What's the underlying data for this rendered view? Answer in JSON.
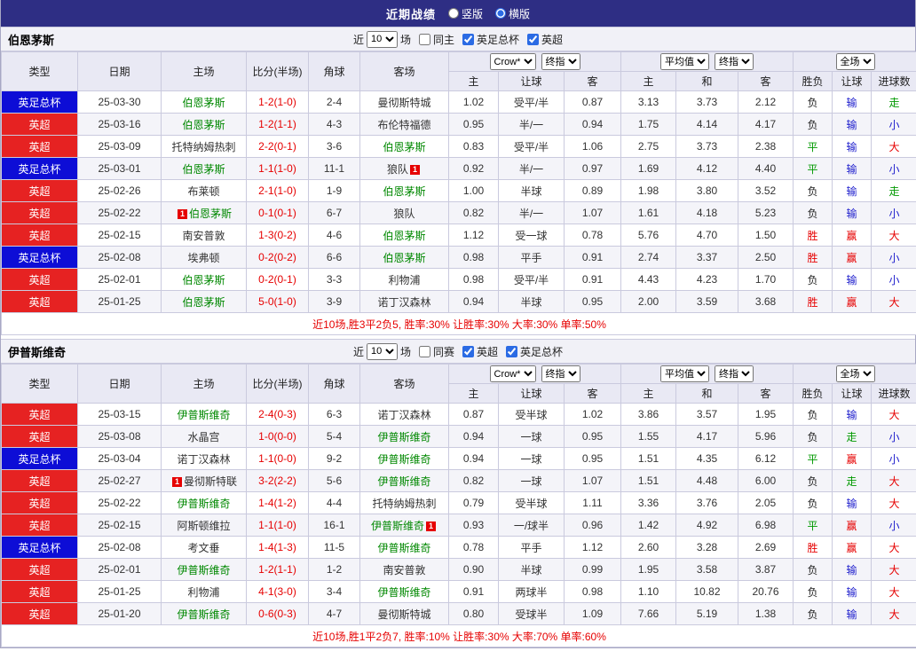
{
  "topbar": {
    "title": "近期战绩",
    "layout_options": [
      {
        "label": "竖版",
        "selected": false
      },
      {
        "label": "横版",
        "selected": true
      }
    ]
  },
  "columns": {
    "type": "类型",
    "date": "日期",
    "home": "主场",
    "score": "比分(半场)",
    "corner": "角球",
    "away": "客场",
    "sub": [
      "主",
      "让球",
      "客",
      "主",
      "和",
      "客",
      "胜负",
      "让球",
      "进球数"
    ]
  },
  "dropdowns": {
    "bookmaker": "Crow*",
    "final": "终指",
    "average": "平均值",
    "scope": "全场"
  },
  "competition_colors": {
    "英超": "red",
    "英足总杯": "blue"
  },
  "result_color_map": {
    "胜": "red",
    "赢": "red",
    "大": "red",
    "平": "green",
    "走": "green",
    "负": "dark",
    "输": "blue",
    "小": "blue"
  },
  "colors": {
    "topbar_bg": "#2e2e84",
    "league_badge_red": "#e62222",
    "cup_badge_blue": "#0d0dd6",
    "win_red": "#e60000",
    "draw_green": "#009900",
    "lose_blue": "#1c1ccc",
    "focus_team_green": "#008800",
    "summary_red": "#e60000"
  },
  "sections": [
    {
      "team": "伯恩茅斯",
      "filter": {
        "near_label": "近",
        "count": "10",
        "unit_label": "场",
        "same_label": "同主",
        "same_checked": false,
        "competitions": [
          {
            "label": "英足总杯",
            "checked": true
          },
          {
            "label": "英超",
            "checked": true
          }
        ]
      },
      "rows": [
        {
          "comp": "英足总杯",
          "date": "25-03-30",
          "home": "伯恩茅斯",
          "score": "1-2(1-0)",
          "corner": "2-4",
          "away": "曼彻斯特城",
          "odds": [
            "1.02",
            "受平/半",
            "0.87",
            "3.13",
            "3.73",
            "2.12"
          ],
          "results": [
            "负",
            "输",
            "走"
          ]
        },
        {
          "comp": "英超",
          "date": "25-03-16",
          "home": "伯恩茅斯",
          "score": "1-2(1-1)",
          "corner": "4-3",
          "away": "布伦特福德",
          "odds": [
            "0.95",
            "半/一",
            "0.94",
            "1.75",
            "4.14",
            "4.17"
          ],
          "results": [
            "负",
            "输",
            "小"
          ]
        },
        {
          "comp": "英超",
          "date": "25-03-09",
          "home": "托特纳姆热刺",
          "score": "2-2(0-1)",
          "corner": "3-6",
          "away": "伯恩茅斯",
          "odds": [
            "0.83",
            "受平/半",
            "1.06",
            "2.75",
            "3.73",
            "2.38"
          ],
          "results": [
            "平",
            "输",
            "大"
          ]
        },
        {
          "comp": "英足总杯",
          "date": "25-03-01",
          "home": "伯恩茅斯",
          "score": "1-1(1-0)",
          "corner": "11-1",
          "away": "狼队",
          "away_card": "right",
          "odds": [
            "0.92",
            "半/一",
            "0.97",
            "1.69",
            "4.12",
            "4.40"
          ],
          "results": [
            "平",
            "输",
            "小"
          ]
        },
        {
          "comp": "英超",
          "date": "25-02-26",
          "home": "布莱顿",
          "score": "2-1(1-0)",
          "corner": "1-9",
          "away": "伯恩茅斯",
          "odds": [
            "1.00",
            "半球",
            "0.89",
            "1.98",
            "3.80",
            "3.52"
          ],
          "results": [
            "负",
            "输",
            "走"
          ]
        },
        {
          "comp": "英超",
          "date": "25-02-22",
          "home": "伯恩茅斯",
          "home_card": "left",
          "score": "0-1(0-1)",
          "corner": "6-7",
          "away": "狼队",
          "odds": [
            "0.82",
            "半/一",
            "1.07",
            "1.61",
            "4.18",
            "5.23"
          ],
          "results": [
            "负",
            "输",
            "小"
          ]
        },
        {
          "comp": "英超",
          "date": "25-02-15",
          "home": "南安普敦",
          "score": "1-3(0-2)",
          "corner": "4-6",
          "away": "伯恩茅斯",
          "odds": [
            "1.12",
            "受一球",
            "0.78",
            "5.76",
            "4.70",
            "1.50"
          ],
          "results": [
            "胜",
            "赢",
            "大"
          ]
        },
        {
          "comp": "英足总杯",
          "date": "25-02-08",
          "home": "埃弗顿",
          "score": "0-2(0-2)",
          "corner": "6-6",
          "away": "伯恩茅斯",
          "odds": [
            "0.98",
            "平手",
            "0.91",
            "2.74",
            "3.37",
            "2.50"
          ],
          "results": [
            "胜",
            "赢",
            "小"
          ]
        },
        {
          "comp": "英超",
          "date": "25-02-01",
          "home": "伯恩茅斯",
          "score": "0-2(0-1)",
          "corner": "3-3",
          "away": "利物浦",
          "odds": [
            "0.98",
            "受平/半",
            "0.91",
            "4.43",
            "4.23",
            "1.70"
          ],
          "results": [
            "负",
            "输",
            "小"
          ]
        },
        {
          "comp": "英超",
          "date": "25-01-25",
          "home": "伯恩茅斯",
          "score": "5-0(1-0)",
          "corner": "3-9",
          "away": "诺丁汉森林",
          "odds": [
            "0.94",
            "半球",
            "0.95",
            "2.00",
            "3.59",
            "3.68"
          ],
          "results": [
            "胜",
            "赢",
            "大"
          ]
        }
      ],
      "summary": "近10场,胜3平2负5, 胜率:30% 让胜率:30% 大率:30% 单率:50%"
    },
    {
      "team": "伊普斯维奇",
      "filter": {
        "near_label": "近",
        "count": "10",
        "unit_label": "场",
        "same_label": "同赛",
        "same_checked": false,
        "competitions": [
          {
            "label": "英超",
            "checked": true
          },
          {
            "label": "英足总杯",
            "checked": true
          }
        ]
      },
      "rows": [
        {
          "comp": "英超",
          "date": "25-03-15",
          "home": "伊普斯维奇",
          "score": "2-4(0-3)",
          "corner": "6-3",
          "away": "诺丁汉森林",
          "odds": [
            "0.87",
            "受半球",
            "1.02",
            "3.86",
            "3.57",
            "1.95"
          ],
          "results": [
            "负",
            "输",
            "大"
          ]
        },
        {
          "comp": "英超",
          "date": "25-03-08",
          "home": "水晶宫",
          "score": "1-0(0-0)",
          "corner": "5-4",
          "away": "伊普斯维奇",
          "odds": [
            "0.94",
            "一球",
            "0.95",
            "1.55",
            "4.17",
            "5.96"
          ],
          "results": [
            "负",
            "走",
            "小"
          ]
        },
        {
          "comp": "英足总杯",
          "date": "25-03-04",
          "home": "诺丁汉森林",
          "score": "1-1(0-0)",
          "corner": "9-2",
          "away": "伊普斯维奇",
          "odds": [
            "0.94",
            "一球",
            "0.95",
            "1.51",
            "4.35",
            "6.12"
          ],
          "results": [
            "平",
            "赢",
            "小"
          ]
        },
        {
          "comp": "英超",
          "date": "25-02-27",
          "home": "曼彻斯特联",
          "home_card": "left",
          "score": "3-2(2-2)",
          "corner": "5-6",
          "away": "伊普斯维奇",
          "odds": [
            "0.82",
            "一球",
            "1.07",
            "1.51",
            "4.48",
            "6.00"
          ],
          "results": [
            "负",
            "走",
            "大"
          ]
        },
        {
          "comp": "英超",
          "date": "25-02-22",
          "home": "伊普斯维奇",
          "score": "1-4(1-2)",
          "corner": "4-4",
          "away": "托特纳姆热刺",
          "odds": [
            "0.79",
            "受半球",
            "1.11",
            "3.36",
            "3.76",
            "2.05"
          ],
          "results": [
            "负",
            "输",
            "大"
          ]
        },
        {
          "comp": "英超",
          "date": "25-02-15",
          "home": "阿斯顿维拉",
          "score": "1-1(1-0)",
          "corner": "16-1",
          "away": "伊普斯维奇",
          "away_card": "right",
          "odds": [
            "0.93",
            "一/球半",
            "0.96",
            "1.42",
            "4.92",
            "6.98"
          ],
          "results": [
            "平",
            "赢",
            "小"
          ]
        },
        {
          "comp": "英足总杯",
          "date": "25-02-08",
          "home": "考文垂",
          "score": "1-4(1-3)",
          "corner": "11-5",
          "away": "伊普斯维奇",
          "odds": [
            "0.78",
            "平手",
            "1.12",
            "2.60",
            "3.28",
            "2.69"
          ],
          "results": [
            "胜",
            "赢",
            "大"
          ]
        },
        {
          "comp": "英超",
          "date": "25-02-01",
          "home": "伊普斯维奇",
          "score": "1-2(1-1)",
          "corner": "1-2",
          "away": "南安普敦",
          "odds": [
            "0.90",
            "半球",
            "0.99",
            "1.95",
            "3.58",
            "3.87"
          ],
          "results": [
            "负",
            "输",
            "大"
          ]
        },
        {
          "comp": "英超",
          "date": "25-01-25",
          "home": "利物浦",
          "score": "4-1(3-0)",
          "corner": "3-4",
          "away": "伊普斯维奇",
          "odds": [
            "0.91",
            "两球半",
            "0.98",
            "1.10",
            "10.82",
            "20.76"
          ],
          "results": [
            "负",
            "输",
            "大"
          ]
        },
        {
          "comp": "英超",
          "date": "25-01-20",
          "home": "伊普斯维奇",
          "score": "0-6(0-3)",
          "corner": "4-7",
          "away": "曼彻斯特城",
          "odds": [
            "0.80",
            "受球半",
            "1.09",
            "7.66",
            "5.19",
            "1.38"
          ],
          "results": [
            "负",
            "输",
            "大"
          ]
        }
      ],
      "summary": "近10场,胜1平2负7, 胜率:10% 让胜率:30% 大率:70% 单率:60%"
    }
  ]
}
